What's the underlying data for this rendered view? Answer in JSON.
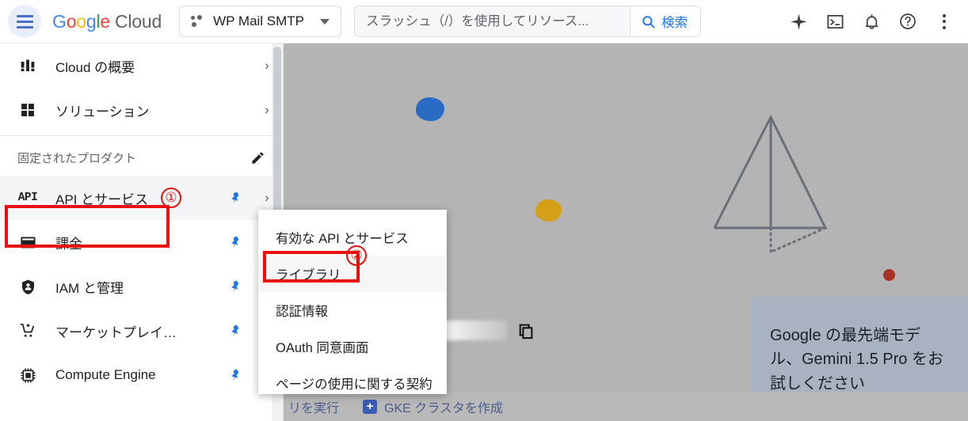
{
  "header": {
    "menu_icon": "hamburger-menu-icon",
    "brand": {
      "g": "G",
      "o1": "o",
      "o2": "o",
      "g2": "g",
      "l": "l",
      "e": "e",
      "cloud": "Cloud"
    },
    "project": {
      "name": "WP Mail SMTP",
      "icon": "project-dots-icon",
      "caret": "chevron-down-icon"
    },
    "search": {
      "placeholder": "スラッシュ（/）を使用してリソース...",
      "value": "",
      "button_label": "検索",
      "icon": "search-icon"
    },
    "icons": [
      {
        "name": "gemini-sparkle-icon",
        "glyph": "✦"
      },
      {
        "name": "cloud-shell-icon",
        "glyph": ">_"
      },
      {
        "name": "notifications-bell-icon",
        "glyph": "🔔"
      },
      {
        "name": "help-icon",
        "glyph": "?"
      },
      {
        "name": "more-options-icon",
        "glyph": "⋮"
      }
    ]
  },
  "sidebar": {
    "top_items": [
      {
        "label": "Cloud の概要",
        "icon": "cloud-overview-icon",
        "chevron": "›",
        "pinned": false
      },
      {
        "label": "ソリューション",
        "icon": "solutions-grid-icon",
        "chevron": "›",
        "pinned": false
      }
    ],
    "section": {
      "title": "固定されたプロダクト",
      "edit_icon": "pencil-edit-icon"
    },
    "pinned_items": [
      {
        "label": "API とサービス",
        "icon": "api-icon",
        "icon_text": "API",
        "chevron": "›",
        "pinned": true,
        "highlighted": true
      },
      {
        "label": "課金",
        "icon": "billing-card-icon",
        "chevron": "",
        "pinned": true,
        "highlighted": false
      },
      {
        "label": "IAM と管理",
        "icon": "iam-shield-icon",
        "chevron": "›",
        "pinned": true,
        "highlighted": false
      },
      {
        "label": "マーケットプレイ…",
        "icon": "marketplace-cart-icon",
        "chevron": "",
        "pinned": true,
        "highlighted": false
      },
      {
        "label": "Compute Engine",
        "icon": "compute-chip-icon",
        "chevron": "›",
        "pinned": true,
        "highlighted": false
      }
    ]
  },
  "submenu": {
    "items": [
      {
        "label": "有効な API とサービス",
        "highlighted": false
      },
      {
        "label": "ライブラリ",
        "highlighted": true
      },
      {
        "label": "認証情報",
        "highlighted": false
      },
      {
        "label": "OAuth 同意画面",
        "highlighted": false
      },
      {
        "label": "ページの使用に関する契約",
        "highlighted": false
      }
    ]
  },
  "main": {
    "gemini_card": {
      "text": "Google の最先端モデル、Gemini 1.5 Pro をお試しください"
    },
    "bottom_buttons": [
      {
        "label": "リを実行",
        "icon": ""
      },
      {
        "label": "GKE クラスタを作成",
        "icon": "plus-icon",
        "icon_glyph": "+"
      }
    ],
    "copy_icon": "copy-icon"
  },
  "annotations": [
    {
      "number": "①",
      "target": "api-and-services-nav-item"
    },
    {
      "number": "②",
      "target": "library-submenu-item"
    }
  ],
  "colors": {
    "accent_blue": "#1a73e8",
    "annotation_red": "#e8110f",
    "canvas_gray": "#b4b4b4",
    "card_blue_gray": "#a9b2c0",
    "blob_blue": "#2a6cc4",
    "blob_gold": "#d4a017",
    "dot_red": "#a93226"
  }
}
